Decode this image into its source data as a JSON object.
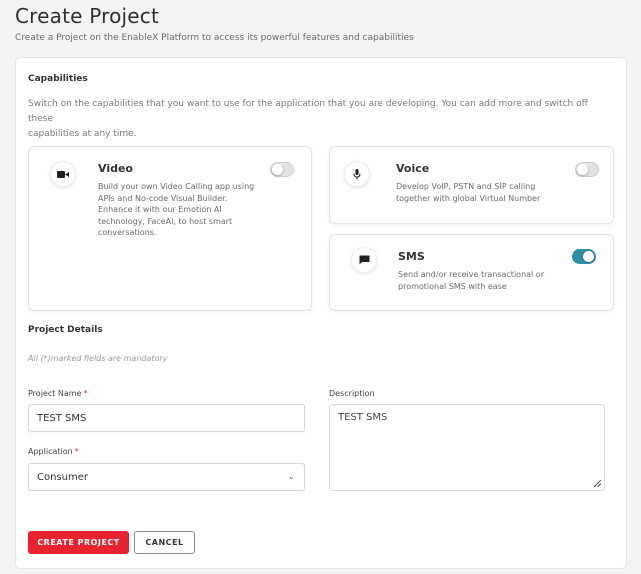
{
  "header": {
    "title": "Create Project",
    "subtitle": "Create a Project on the EnableX Platform to access its powerful features and capabilities"
  },
  "capabilities": {
    "title": "Capabilities",
    "description_line1": "Switch on the capabilities that you want to use for the application that you are developing. You can add more and switch off these",
    "description_line2": "capabilities at any time.",
    "items": [
      {
        "name": "Video",
        "icon": "video-camera-icon",
        "enabled": false,
        "desc": [
          "Build your own Video Calling app using",
          "APIs and No-code Visual Builder.",
          "Enhance it with our Emotion AI",
          "technology, FaceAI, to host smart",
          "conversations."
        ]
      },
      {
        "name": "Voice",
        "icon": "microphone-icon",
        "enabled": false,
        "desc": [
          "Develop VoIP, PSTN and SIP calling",
          "together with global Virtual Number"
        ]
      },
      {
        "name": "SMS",
        "icon": "chat-bubble-icon",
        "enabled": true,
        "desc": [
          "Send and/or receive transactional or",
          "promotional SMS with ease"
        ]
      }
    ]
  },
  "project_details": {
    "title": "Project Details",
    "mandatory_note": "All (*)marked fields are mandatory",
    "project_name": {
      "label": "Project Name",
      "required": "*",
      "value": "TEST SMS"
    },
    "application": {
      "label": "Application",
      "required": "*",
      "value": "Consumer"
    },
    "description": {
      "label": "Description",
      "value": "TEST SMS"
    }
  },
  "actions": {
    "create_label": "CREATE PROJECT",
    "cancel_label": "CANCEL"
  },
  "colors": {
    "accent_red": "#e8232f",
    "toggle_on": "#2e8fa6",
    "page_bg": "#f3f4f6"
  }
}
